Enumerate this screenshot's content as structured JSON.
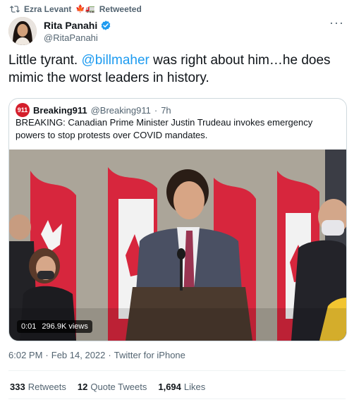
{
  "retweeter": {
    "name": "Ezra Levant",
    "emojis": "🍁🚛",
    "label": "Retweeted",
    "icon": "retweet-icon"
  },
  "author": {
    "display_name": "Rita Panahi",
    "handle": "@RitaPanahi",
    "verified": true,
    "verified_color": "#1d9bf0",
    "more_icon": "more-options-icon"
  },
  "tweet": {
    "text_before": "Little tyrant. ",
    "mention": "@billmaher",
    "text_after": " was right about him…he does mimic the worst leaders in history.",
    "mention_color": "#1d9bf0"
  },
  "quote": {
    "name": "Breaking911",
    "handle": "@Breaking911",
    "separator": "·",
    "age": "7h",
    "avatar_label": "911",
    "text": "BREAKING: Canadian Prime Minister Justin Trudeau invokes emergency powers to stop protests over COVID mandates.",
    "video": {
      "time": "0:01",
      "views": "296.9K views"
    }
  },
  "meta": {
    "time": "6:02 PM",
    "separator1": "·",
    "date": "Feb 14, 2022",
    "separator2": "·",
    "source": "Twitter for iPhone"
  },
  "stats": {
    "retweets_count": "333",
    "retweets_label": "Retweets",
    "quotes_count": "12",
    "quotes_label": "Quote Tweets",
    "likes_count": "1,694",
    "likes_label": "Likes"
  }
}
